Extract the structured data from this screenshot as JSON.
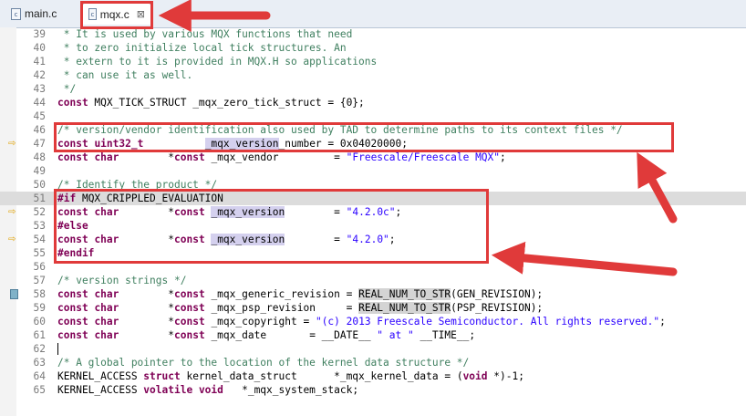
{
  "tabs": [
    {
      "label": "main.c",
      "icon": "c-file-icon",
      "active": false
    },
    {
      "label": "mqx.c",
      "icon": "c-file-icon",
      "active": true
    }
  ],
  "file_icon_letter": "c",
  "close_glyph": "⊠",
  "lines": [
    {
      "num": "39",
      "text": " * It is used by various MQX functions that need"
    },
    {
      "num": "40",
      "text": " * to zero initialize local tick structures. An"
    },
    {
      "num": "41",
      "text": " * extern to it is provided in MQX.H so applications"
    },
    {
      "num": "42",
      "text": " * can use it as well."
    },
    {
      "num": "43",
      "text": " */"
    },
    {
      "num": "44",
      "text": "const MQX_TICK_STRUCT _mqx_zero_tick_struct = {0};"
    },
    {
      "num": "45",
      "text": ""
    },
    {
      "num": "46",
      "text": "/* version/vendor identification also used by TAD to determine paths to its context files */"
    },
    {
      "num": "47",
      "text": "const uint32_t          _mqx_version_number = 0x04020000;"
    },
    {
      "num": "48",
      "text": "const char        *const _mqx_vendor         = \"Freescale/Freescale MQX\";"
    },
    {
      "num": "49",
      "text": ""
    },
    {
      "num": "50",
      "text": "/* Identify the product */"
    },
    {
      "num": "51",
      "text": "#if MQX_CRIPPLED_EVALUATION"
    },
    {
      "num": "52",
      "text": "const char        *const _mqx_version        = \"4.2.0c\";"
    },
    {
      "num": "53",
      "text": "#else"
    },
    {
      "num": "54",
      "text": "const char        *const _mqx_version        = \"4.2.0\";"
    },
    {
      "num": "55",
      "text": "#endif"
    },
    {
      "num": "56",
      "text": ""
    },
    {
      "num": "57",
      "text": "/* version strings */"
    },
    {
      "num": "58",
      "text": "const char        *const _mqx_generic_revision = REAL_NUM_TO_STR(GEN_REVISION);"
    },
    {
      "num": "59",
      "text": "const char        *const _mqx_psp_revision     = REAL_NUM_TO_STR(PSP_REVISION);"
    },
    {
      "num": "60",
      "text": "const char        *const _mqx_copyright = \"(c) 2013 Freescale Semiconductor. All rights reserved.\";"
    },
    {
      "num": "61",
      "text": "const char        *const _mqx_date       = __DATE__ \" at \" __TIME__;"
    },
    {
      "num": "62",
      "text": ""
    },
    {
      "num": "63",
      "text": "/* A global pointer to the location of the kernel data structure */"
    },
    {
      "num": "64",
      "text": "KERNEL_ACCESS struct kernel_data_struct      *_mqx_kernel_data = (void *)-1;"
    },
    {
      "num": "65",
      "text": "KERNEL_ACCESS volatile void   *_mqx_system_stack;"
    }
  ],
  "markers": {
    "arrow_lines": [
      "47",
      "52",
      "54"
    ],
    "block_lines": [
      "58"
    ],
    "arrow_glyph": "⇨"
  },
  "colors": {
    "annotation": "#e03a3a",
    "keyword": "#7f0055",
    "comment": "#3f7f5f",
    "string": "#2a00ff",
    "occurrence_highlight": "#d4d0ee"
  }
}
